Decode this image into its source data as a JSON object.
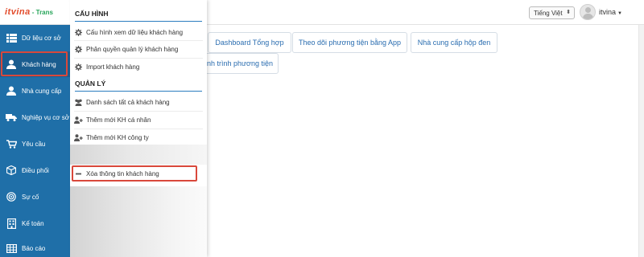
{
  "header": {
    "logo_brand": "itvina",
    "logo_suffix": "- Trans",
    "language": "Tiếng Việt",
    "username": "itvina"
  },
  "sidebar": {
    "items": [
      {
        "label": "Dữ liệu cơ sở",
        "icon": "list-icon"
      },
      {
        "label": "Khách hàng",
        "icon": "user-icon"
      },
      {
        "label": "Nhà cung cấp",
        "icon": "user-icon"
      },
      {
        "label": "Nghiệp vụ cơ sở",
        "icon": "truck-icon"
      },
      {
        "label": "Yêu cầu",
        "icon": "cart-icon"
      },
      {
        "label": "Điều phối",
        "icon": "cube-icon"
      },
      {
        "label": "Sự cố",
        "icon": "bullseye-icon"
      },
      {
        "label": "Kế toán",
        "icon": "building-icon"
      },
      {
        "label": "Báo cáo",
        "icon": "table-icon"
      }
    ]
  },
  "tabs": {
    "dashboard": "Dashboard Tổng hợp",
    "track_app": "Theo dõi phương tiện bằng App",
    "blackbox": "Nhà cung cấp hộp đen",
    "itinerary": "nh trình phương tiện"
  },
  "dropdown": {
    "config_title": "CẤU HÌNH",
    "config_items": [
      "Cấu hình xem dữ liệu khách hàng",
      "Phân quyền quản lý khách hàng",
      "Import khách hàng"
    ],
    "manage_title": "QUẢN LÝ",
    "manage_items": [
      "Danh sách tất cả khách hàng",
      "Thêm mới KH cá nhân",
      "Thêm mới KH công ty"
    ],
    "delete_item": "Xóa thông tin khách hàng"
  },
  "colors": {
    "sidebar_bg": "#1f6fa8",
    "accent_line": "#2a7dbf",
    "highlight": "#d9483b"
  }
}
